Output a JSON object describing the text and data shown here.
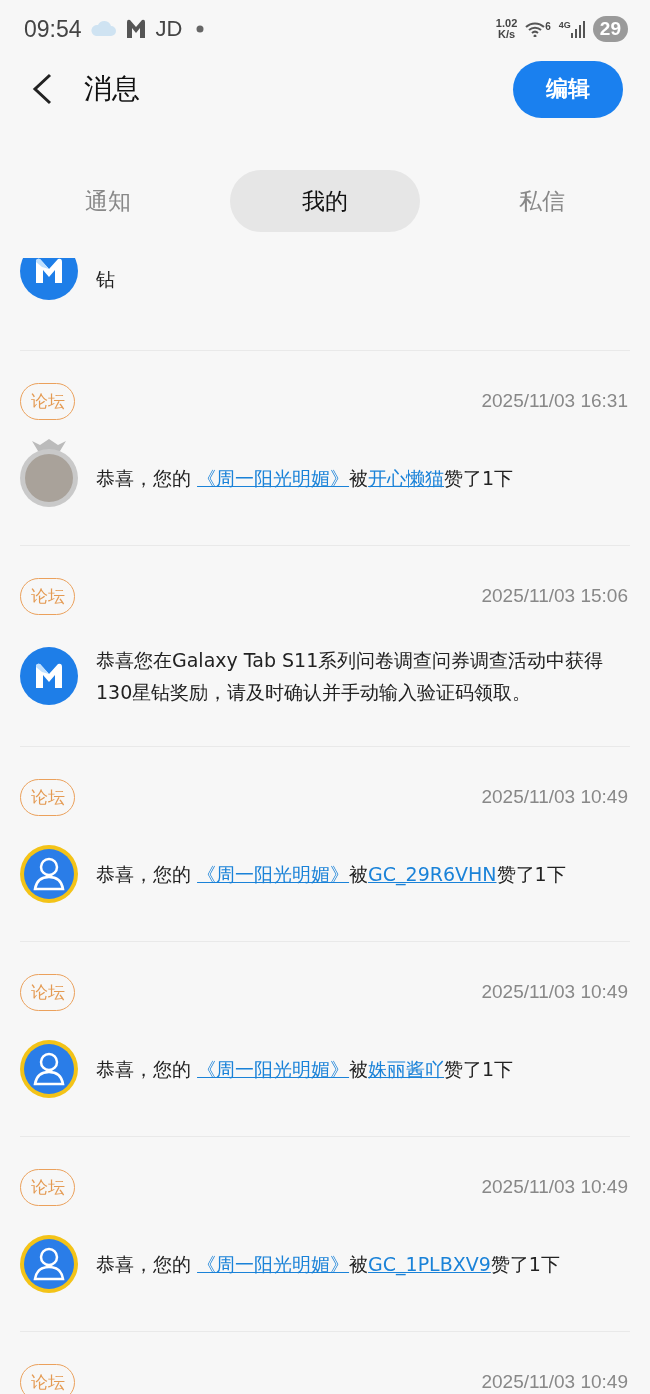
{
  "status_bar": {
    "time": "09:54",
    "carrier_label": "JD",
    "net_speed_value": "1.02",
    "net_speed_unit": "K/s",
    "network_type": "4G",
    "wifi_band": "6",
    "battery": "29"
  },
  "header": {
    "title": "消息",
    "edit_button": "编辑"
  },
  "tabs": [
    {
      "label": "通知",
      "selected": false
    },
    {
      "label": "我的",
      "selected": true
    },
    {
      "label": "私信",
      "selected": false
    }
  ],
  "messages": [
    {
      "kind": "partial",
      "avatar": {
        "kind": "brand"
      },
      "text": "钻"
    },
    {
      "kind": "like",
      "tag": "论坛",
      "time": "2025/11/03 16:31",
      "avatar": {
        "kind": "photo"
      },
      "prefix": "恭喜，您的",
      "post": "《周一阳光明媚》",
      "by": "被",
      "user": "开心懒猫",
      "suffix": "赞了1下"
    },
    {
      "kind": "system",
      "tag": "论坛",
      "time": "2025/11/03 15:06",
      "avatar": {
        "kind": "brand"
      },
      "text": "恭喜您在Galaxy Tab S11系列问卷调查问券调查活动中获得130星钻奖励，请及时确认并手动输入验证码领取。"
    },
    {
      "kind": "like",
      "tag": "论坛",
      "time": "2025/11/03 10:49",
      "avatar": {
        "kind": "default"
      },
      "prefix": "恭喜，您的",
      "post": "《周一阳光明媚》",
      "by": "被",
      "user": "GC_29R6VHN",
      "suffix": "赞了1下"
    },
    {
      "kind": "like",
      "tag": "论坛",
      "time": "2025/11/03 10:49",
      "avatar": {
        "kind": "default"
      },
      "prefix": "恭喜，您的",
      "post": "《周一阳光明媚》",
      "by": "被",
      "user": "姝丽酱吖",
      "suffix": "赞了1下"
    },
    {
      "kind": "like",
      "tag": "论坛",
      "time": "2025/11/03 10:49",
      "avatar": {
        "kind": "default"
      },
      "prefix": "恭喜，您的",
      "post": "《周一阳光明媚》",
      "by": "被",
      "user": "GC_1PLBXV9",
      "suffix": "赞了1下"
    },
    {
      "kind": "header_only",
      "tag": "论坛",
      "time": "2025/11/03 10:49"
    }
  ]
}
